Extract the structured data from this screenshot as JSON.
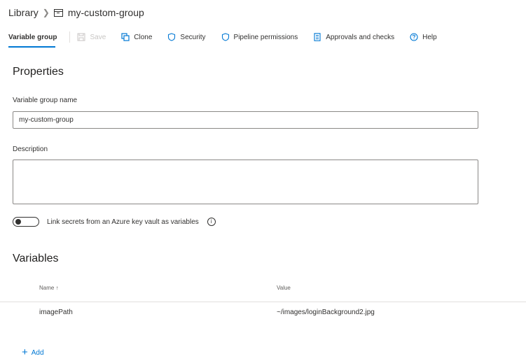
{
  "breadcrumb": {
    "root": "Library",
    "separator": ">",
    "current": "my-custom-group",
    "current_icon": "library-icon"
  },
  "toolbar": {
    "active_tab": "Variable group",
    "save": "Save",
    "clone": "Clone",
    "security": "Security",
    "pipeline_permissions": "Pipeline permissions",
    "approvals": "Approvals and checks",
    "help": "Help"
  },
  "properties": {
    "title": "Properties",
    "name_label": "Variable group name",
    "name_value": "my-custom-group",
    "description_label": "Description",
    "description_value": "",
    "link_secrets_label": "Link secrets from an Azure key vault as variables",
    "link_secrets_enabled": false
  },
  "variables": {
    "title": "Variables",
    "columns": {
      "name": "Name ↑",
      "value": "Value"
    },
    "rows": [
      {
        "name": "imagePath",
        "value": "~/images/loginBackground2.jpg"
      }
    ],
    "add_label": "Add"
  },
  "colors": {
    "accent": "#0078d4",
    "text": "#323130",
    "disabled": "#c8c6c4",
    "border": "#8a8886"
  }
}
